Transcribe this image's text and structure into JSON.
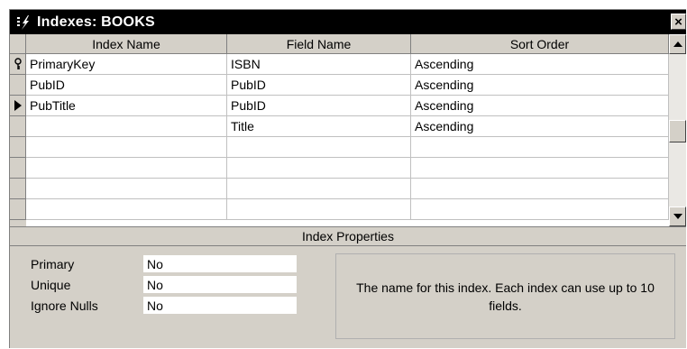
{
  "window": {
    "title": "Indexes: BOOKS",
    "close_label": "×"
  },
  "grid": {
    "columns": [
      "Index Name",
      "Field Name",
      "Sort Order"
    ],
    "rows": [
      {
        "selector": "key-icon",
        "index_name": "PrimaryKey",
        "field_name": "ISBN",
        "sort_order": "Ascending"
      },
      {
        "selector": "",
        "index_name": "PubID",
        "field_name": "PubID",
        "sort_order": "Ascending"
      },
      {
        "selector": "current-row-arrow-icon",
        "index_name": "PubTitle",
        "field_name": "PubID",
        "sort_order": "Ascending"
      },
      {
        "selector": "",
        "index_name": "",
        "field_name": "Title",
        "sort_order": "Ascending"
      },
      {
        "selector": "",
        "index_name": "",
        "field_name": "",
        "sort_order": ""
      },
      {
        "selector": "",
        "index_name": "",
        "field_name": "",
        "sort_order": ""
      },
      {
        "selector": "",
        "index_name": "",
        "field_name": "",
        "sort_order": ""
      },
      {
        "selector": "",
        "index_name": "",
        "field_name": "",
        "sort_order": ""
      }
    ]
  },
  "properties": {
    "title": "Index Properties",
    "primary": {
      "label": "Primary",
      "value": "No"
    },
    "unique": {
      "label": "Unique",
      "value": "No"
    },
    "ignore_nulls": {
      "label": "Ignore Nulls",
      "value": "No"
    },
    "help_text": "The name for this index.  Each index can use up to 10 fields."
  },
  "colors": {
    "titlebar": "#000000",
    "chrome": "#d4d0c8",
    "grid_bg": "#ffffff"
  }
}
